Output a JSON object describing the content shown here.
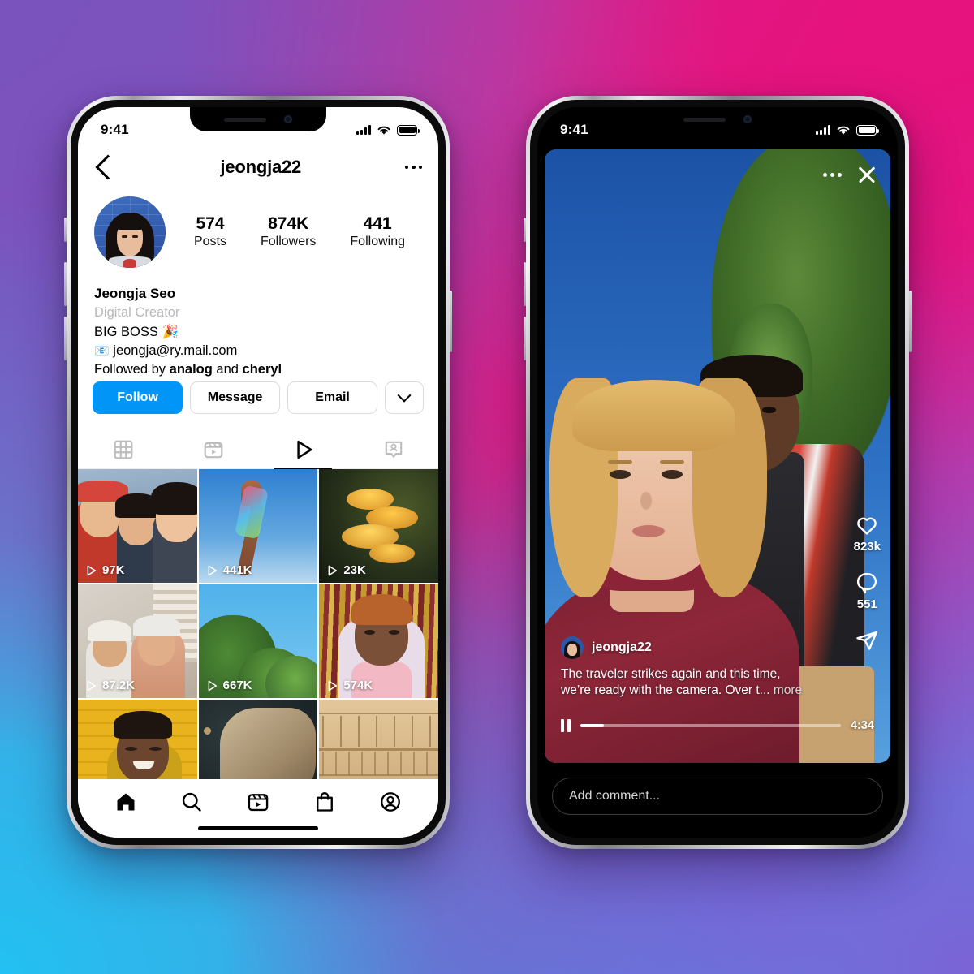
{
  "background": {
    "gradient_from": "#e6127e",
    "gradient_mid": "#7b53bd",
    "gradient_to": "#22c1f2"
  },
  "colors": {
    "accent_blue": "#0095F6",
    "text_dark": "#000000",
    "muted": "#b9b9bd"
  },
  "left_phone": {
    "status_bar": {
      "time": "9:41",
      "signal_icon": "signal-bars-icon",
      "wifi_icon": "wifi-icon",
      "battery_icon": "battery-icon"
    },
    "header": {
      "back_icon": "back-chevron-icon",
      "title": "jeongja22",
      "menu_icon": "more-options-icon"
    },
    "avatar_name": "profile-avatar",
    "stats": [
      {
        "num": "574",
        "label": "Posts"
      },
      {
        "num": "874K",
        "label": "Followers"
      },
      {
        "num": "441",
        "label": "Following"
      }
    ],
    "bio": {
      "display_name": "Jeongja Seo",
      "category": "Digital Creator",
      "line1": "BIG BOSS 🎉",
      "email_icon": "email-badge-icon",
      "email": "jeongja@ry.mail.com",
      "followed_prefix": "Followed by ",
      "followed_names": "analog",
      "followed_join": " and ",
      "followed_names2": "cheryl"
    },
    "buttons": {
      "follow": "Follow",
      "message": "Message",
      "email": "Email",
      "more_icon": "chevron-down-icon"
    },
    "tabs": [
      {
        "name": "grid-tab",
        "icon": "grid-icon",
        "active": false
      },
      {
        "name": "reels-tab",
        "icon": "reels-icon",
        "active": false
      },
      {
        "name": "video-tab",
        "icon": "play-triangle-icon",
        "active": true
      },
      {
        "name": "tagged-tab",
        "icon": "tagged-person-icon",
        "active": false
      }
    ],
    "grid": [
      {
        "views": "97K",
        "alt": "three-friends-selfie"
      },
      {
        "views": "441K",
        "alt": "glitter-hand-sky"
      },
      {
        "views": "23K",
        "alt": "yellow-mushrooms"
      },
      {
        "views": "87.2K",
        "alt": "two-people-headphones"
      },
      {
        "views": "667K",
        "alt": "tree-blue-sky"
      },
      {
        "views": "574K",
        "alt": "person-gold-tinsel"
      },
      {
        "views": "",
        "alt": "person-yellow-brick-wall"
      },
      {
        "views": "",
        "alt": "rock-texture"
      },
      {
        "views": "",
        "alt": "egyptian-relief-carving"
      }
    ],
    "bottom_nav": [
      {
        "name": "nav-home",
        "icon": "home-icon",
        "active": true
      },
      {
        "name": "nav-search",
        "icon": "search-icon",
        "active": false
      },
      {
        "name": "nav-reels",
        "icon": "reels-icon",
        "active": false
      },
      {
        "name": "nav-shop",
        "icon": "shop-bag-icon",
        "active": false
      },
      {
        "name": "nav-profile",
        "icon": "profile-circle-icon",
        "active": false
      }
    ]
  },
  "right_phone": {
    "status_bar": {
      "time": "9:41",
      "signal_icon": "signal-bars-icon",
      "wifi_icon": "wifi-icon",
      "battery_icon": "battery-icon"
    },
    "top_actions": {
      "menu_icon": "more-options-icon",
      "close_icon": "close-x-icon"
    },
    "side_actions": {
      "like_icon": "heart-icon",
      "like_count": "823k",
      "comment_icon": "comment-bubble-icon",
      "comment_count": "551",
      "share_icon": "share-paper-plane-icon"
    },
    "post": {
      "username": "jeongja22",
      "avatar_name": "reel-author-avatar",
      "caption_line1": "The traveler strikes again and this time,",
      "caption_line2": "we’re ready with the camera. Over t...",
      "more_label": "more"
    },
    "player": {
      "pause_icon": "pause-icon",
      "progress_percent": 9,
      "duration": "4:34"
    },
    "comment_input": {
      "placeholder": "Add comment...",
      "value": ""
    }
  }
}
